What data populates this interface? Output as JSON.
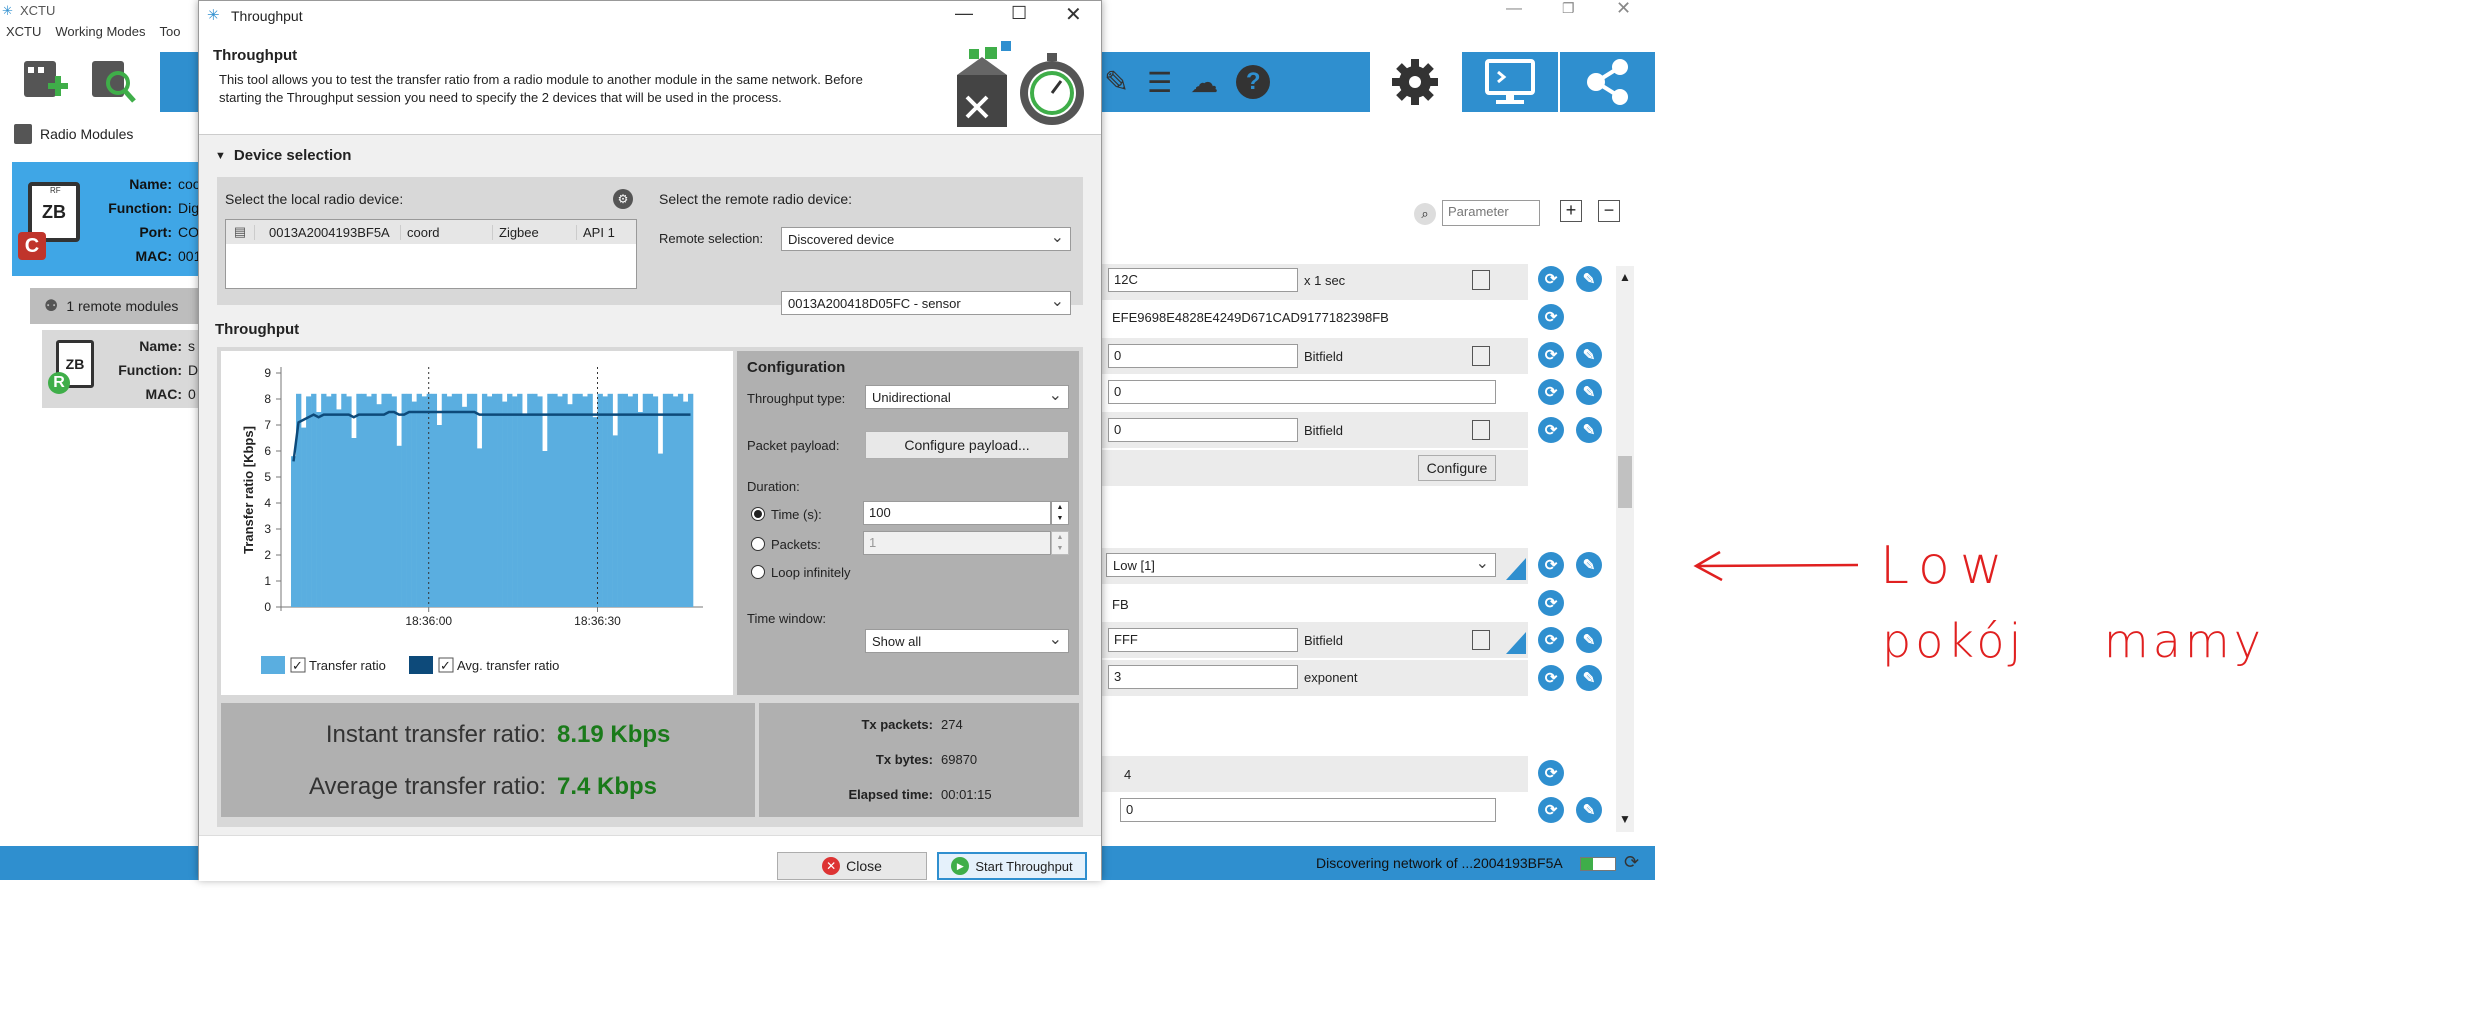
{
  "main_window": {
    "title": "XCTU",
    "menu": [
      "XCTU",
      "Working Modes",
      "Too"
    ],
    "radio_modules_label": "Radio Modules",
    "local_device": {
      "badge": "C",
      "chip": "ZB",
      "chip_top": "RF",
      "labels": [
        "Name:",
        "Function:",
        "Port:",
        "MAC:"
      ],
      "values": [
        "coo",
        "Dig",
        "CO",
        "001"
      ]
    },
    "remote_header": "1 remote modules",
    "remote_device": {
      "badge": "R",
      "chip": "ZB",
      "labels": [
        "Name:",
        "Function:",
        "MAC:"
      ],
      "values": [
        "s",
        "D",
        "0"
      ]
    },
    "search_placeholder": "Parameter",
    "params": [
      {
        "value": "12C",
        "suffix": "x 1 sec"
      },
      {
        "value": "EFE9698E4828E4249D671CAD9177182398FB"
      },
      {
        "value": "0",
        "suffix": "Bitfield"
      },
      {
        "value": "0"
      },
      {
        "value": "0",
        "suffix": "Bitfield"
      },
      {
        "button": "Configure"
      },
      {
        "value": "Low [1]"
      },
      {
        "value": "FB"
      },
      {
        "value": "FFF",
        "suffix": "Bitfield"
      },
      {
        "value": "3",
        "suffix": "exponent"
      },
      {
        "value": "4"
      },
      {
        "value": "0"
      }
    ],
    "status": "Discovering network of ...2004193BF5A"
  },
  "annotation": {
    "line1": "Low",
    "line2": "pokój mamy",
    "color": "#e02020"
  },
  "dialog": {
    "title": "Throughput",
    "heading": "Throughput",
    "description": "This tool allows you to test the transfer ratio from a radio module to another module in the same network. Before starting the Throughput session you need to specify the 2 devices that will be used in the process.",
    "device_selection": "Device selection",
    "local_label": "Select the local radio device:",
    "local_row": [
      "0013A2004193BF5A",
      "coord",
      "Zigbee",
      "API 1"
    ],
    "remote_label": "Select the remote radio device:",
    "remote_selection_label": "Remote selection:",
    "remote_selection_value": "Discovered device",
    "remote_device_value": "0013A200418D05FC - sensor",
    "throughput_section": "Throughput",
    "configuration": {
      "title": "Configuration",
      "throughput_type_label": "Throughput type:",
      "throughput_type_value": "Unidirectional",
      "packet_payload_label": "Packet payload:",
      "configure_payload": "Configure payload...",
      "duration_label": "Duration:",
      "time_label": "Time (s):",
      "time_value": "100",
      "packets_label": "Packets:",
      "packets_value": "1",
      "loop_label": "Loop infinitely",
      "time_window_label": "Time window:",
      "time_window_value": "Show all"
    },
    "instant_label": "Instant transfer ratio:",
    "instant_value": "8.19 Kbps",
    "average_label": "Average transfer ratio:",
    "average_value": "7.4 Kbps",
    "stats": [
      {
        "label": "Tx packets:",
        "value": "274"
      },
      {
        "label": "Tx bytes:",
        "value": "69870"
      },
      {
        "label": "Elapsed time:",
        "value": "00:01:15"
      }
    ],
    "close_button": "Close",
    "start_button": "Start Throughput"
  },
  "chart_data": {
    "type": "bar",
    "ylabel": "Transfer ratio [Kbps]",
    "ylim": [
      0,
      9
    ],
    "yticks": [
      "0",
      "1",
      "2",
      "3",
      "4",
      "5",
      "6",
      "7",
      "8",
      "9"
    ],
    "xticks": [
      "18:36:00",
      "18:36:30"
    ],
    "x_gridlines_at": [
      0.35,
      0.75
    ],
    "legend": [
      "Transfer ratio",
      "Avg. transfer ratio"
    ],
    "series": [
      {
        "name": "Transfer ratio",
        "color": "#5aaee0",
        "values": [
          5.8,
          8.2,
          6.9,
          8.1,
          8.2,
          7.5,
          8.2,
          8.1,
          8.2,
          7.6,
          8.2,
          8.1,
          6.5,
          8.2,
          8.2,
          8.1,
          8.2,
          7.8,
          8.2,
          8.2,
          8.1,
          6.2,
          8.2,
          8.2,
          7.9,
          8.2,
          8.1,
          8.2,
          8.2,
          7.0,
          8.2,
          8.1,
          8.2,
          8.2,
          7.7,
          8.2,
          8.2,
          6.1,
          8.2,
          8.1,
          8.2,
          8.2,
          7.9,
          8.2,
          8.1,
          8.2,
          7.4,
          8.2,
          8.2,
          8.1,
          6.0,
          8.2,
          8.2,
          8.1,
          8.2,
          7.8,
          8.2,
          8.2,
          8.1,
          8.2,
          7.3,
          8.2,
          8.1,
          8.2,
          6.6,
          8.2,
          8.2,
          8.1,
          8.2,
          7.5,
          8.2,
          8.2,
          8.1,
          5.9,
          8.2,
          8.2,
          8.1,
          8.2,
          7.9,
          8.2
        ]
      },
      {
        "name": "Avg. transfer ratio",
        "color": "#0d4a7a",
        "values": [
          5.6,
          7.1,
          7.2,
          7.3,
          7.4,
          7.3,
          7.4,
          7.4,
          7.4,
          7.4,
          7.4,
          7.4,
          7.3,
          7.4,
          7.4,
          7.4,
          7.4,
          7.4,
          7.4,
          7.5,
          7.5,
          7.4,
          7.4,
          7.5,
          7.5,
          7.5,
          7.5,
          7.5,
          7.5,
          7.5,
          7.5,
          7.5,
          7.5,
          7.5,
          7.5,
          7.5,
          7.5,
          7.4,
          7.4,
          7.4,
          7.4,
          7.4,
          7.4,
          7.4,
          7.4,
          7.4,
          7.4,
          7.4,
          7.4,
          7.4,
          7.4,
          7.4,
          7.4,
          7.4,
          7.4,
          7.4,
          7.4,
          7.4,
          7.4,
          7.4,
          7.4,
          7.4,
          7.4,
          7.4,
          7.4,
          7.4,
          7.4,
          7.4,
          7.4,
          7.4,
          7.4,
          7.4,
          7.4,
          7.4,
          7.4,
          7.4,
          7.4,
          7.4,
          7.4,
          7.4
        ]
      }
    ]
  }
}
